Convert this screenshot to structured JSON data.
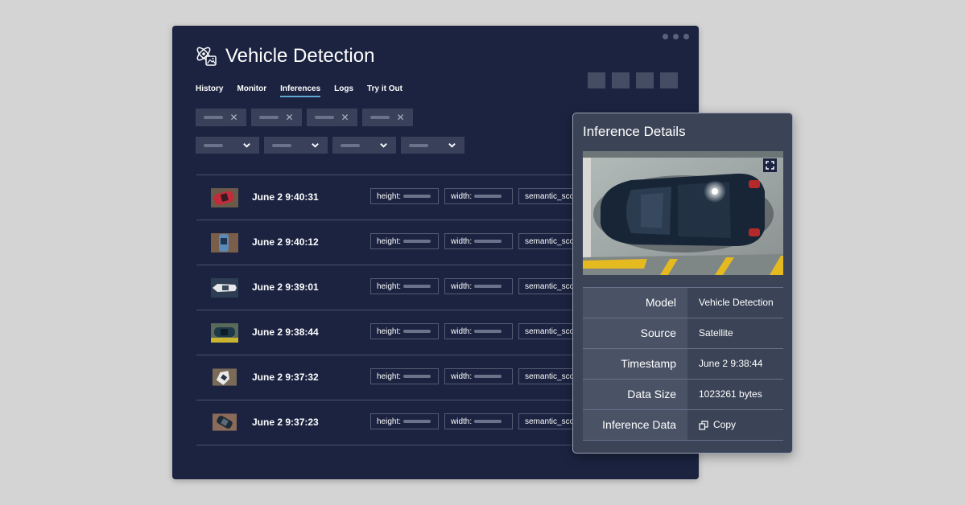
{
  "app": {
    "title": "Vehicle Detection",
    "icon": "ai-vision-icon"
  },
  "tabs": [
    {
      "label": "History"
    },
    {
      "label": "Monitor"
    },
    {
      "label": "Inferences",
      "active": true
    },
    {
      "label": "Logs"
    },
    {
      "label": "Try it Out"
    }
  ],
  "rows": [
    {
      "time": "June 2 9:40:31",
      "height_label": "height:",
      "width_label": "width:",
      "score_label": "semantic_score"
    },
    {
      "time": "June 2 9:40:12",
      "height_label": "height:",
      "width_label": "width:",
      "score_label": "semantic_score"
    },
    {
      "time": "June 2 9:39:01",
      "height_label": "height:",
      "width_label": "width:",
      "score_label": "semantic_score"
    },
    {
      "time": "June 2 9:38:44",
      "height_label": "height:",
      "width_label": "width:",
      "score_label": "semantic_score"
    },
    {
      "time": "June 2 9:37:32",
      "height_label": "height:",
      "width_label": "width:",
      "score_label": "semantic_score"
    },
    {
      "time": "June 2 9:37:23",
      "height_label": "height:",
      "width_label": "width:",
      "score_label": "semantic_score"
    }
  ],
  "details": {
    "title": "Inference Details",
    "rows": [
      {
        "label": "Model",
        "value": "Vehicle Detection"
      },
      {
        "label": "Source",
        "value": "Satellite"
      },
      {
        "label": "Timestamp",
        "value": "June 2 9:38:44"
      },
      {
        "label": "Data Size",
        "value": "1023261 bytes"
      },
      {
        "label": "Inference Data",
        "value": "Copy"
      }
    ]
  },
  "colors": {
    "app_bg": "#1b2340",
    "panel_bg": "#3b4457",
    "accent": "#5fa8d3",
    "page_bg": "#d4d4d4"
  }
}
